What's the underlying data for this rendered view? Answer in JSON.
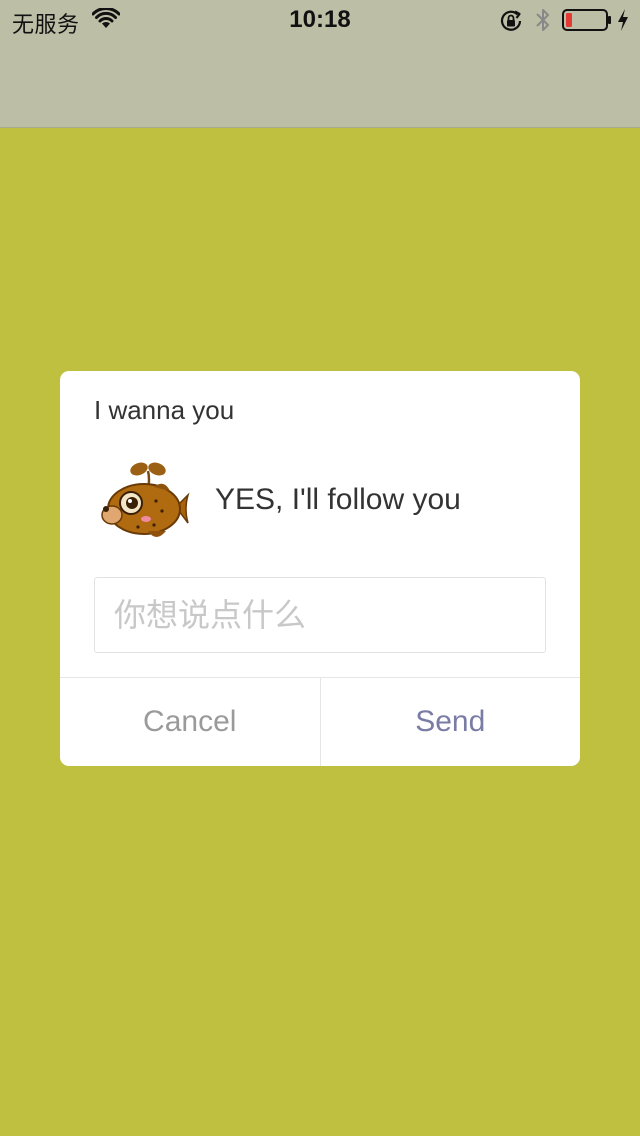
{
  "status_bar": {
    "carrier": "无服务",
    "time": "10:18",
    "icons": [
      "wifi-icon",
      "lock-rotation-icon",
      "bluetooth-icon",
      "battery-icon",
      "charging-icon"
    ]
  },
  "colors": {
    "background": "#c0c040",
    "nav_bar": "#bcbea6",
    "battery_low": "#e53935",
    "send_button": "#7a7ca6",
    "cancel_button": "#9a9a9a"
  },
  "dialog": {
    "title": "I wanna you",
    "avatar": "cartoon-fish-avatar",
    "message": "YES, I'll follow you",
    "input": {
      "value": "",
      "placeholder": "你想说点什么"
    },
    "buttons": {
      "cancel": "Cancel",
      "send": "Send"
    }
  }
}
